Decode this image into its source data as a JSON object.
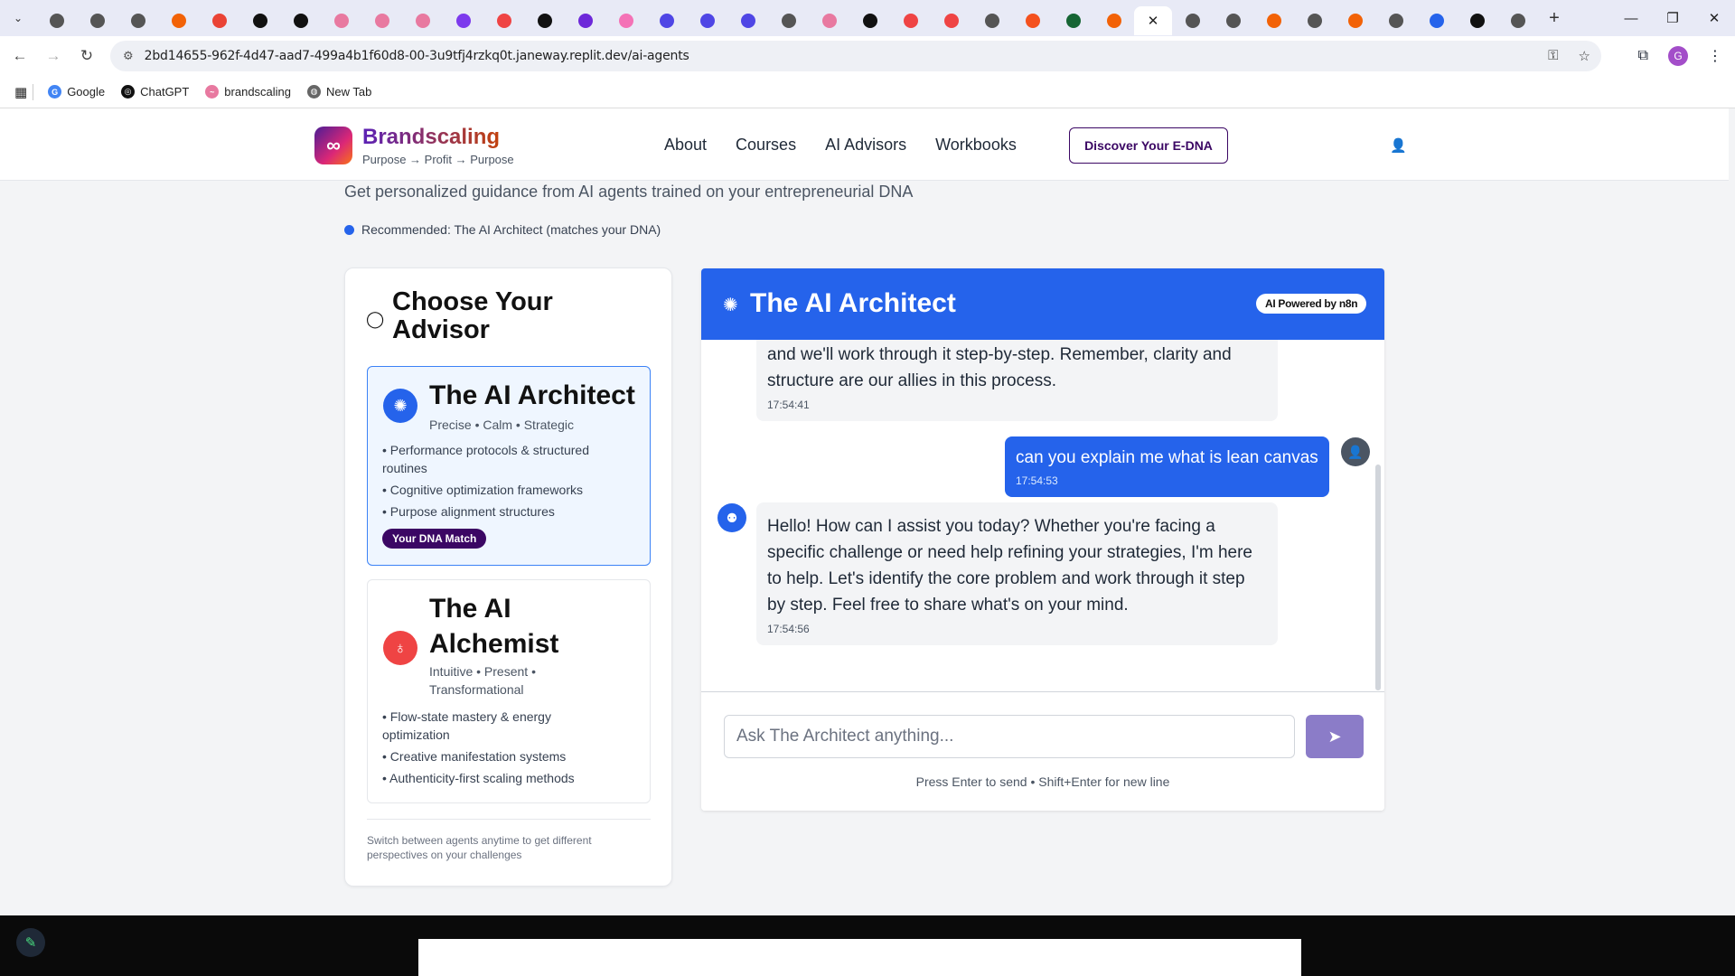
{
  "browser": {
    "url": "2bd14655-962f-4d47-aad7-499a4b1f60d8-00-3u9tfj4rzkq0t.janeway.replit.dev/ai-agents",
    "tabs": [
      {
        "icon": "extension-icon",
        "color": "#555"
      },
      {
        "icon": "extension-icon",
        "color": "#555"
      },
      {
        "icon": "extension-icon",
        "color": "#555"
      },
      {
        "icon": "replit-icon",
        "color": "#f26207"
      },
      {
        "icon": "gmail-icon",
        "color": "#ea4335"
      },
      {
        "icon": "chatgpt-icon",
        "color": "#111"
      },
      {
        "icon": "chatgpt-icon",
        "color": "#111"
      },
      {
        "icon": "brandscaling-icon",
        "color": "#e879a0"
      },
      {
        "icon": "brandscaling-icon",
        "color": "#e879a0"
      },
      {
        "icon": "brandscaling-icon",
        "color": "#e879a0"
      },
      {
        "icon": "app-icon",
        "color": "#7c3aed"
      },
      {
        "icon": "app-icon",
        "color": "#ef4444"
      },
      {
        "icon": "app-icon",
        "color": "#111"
      },
      {
        "icon": "app-icon",
        "color": "#6d28d9"
      },
      {
        "icon": "app-icon",
        "color": "#f472b6"
      },
      {
        "icon": "target-icon",
        "color": "#4f46e5"
      },
      {
        "icon": "target-icon",
        "color": "#4f46e5"
      },
      {
        "icon": "target-icon",
        "color": "#4f46e5"
      },
      {
        "icon": "globe-icon",
        "color": "#555"
      },
      {
        "icon": "brandscaling-icon",
        "color": "#e879a0"
      },
      {
        "icon": "chatgpt-icon",
        "color": "#111"
      },
      {
        "icon": "youtube-icon",
        "color": "#ef4444"
      },
      {
        "icon": "youtube-icon",
        "color": "#ef4444"
      },
      {
        "icon": "globe-icon",
        "color": "#555"
      },
      {
        "icon": "app-icon",
        "color": "#f4511e"
      },
      {
        "icon": "app-icon",
        "color": "#166534"
      },
      {
        "icon": "replit-icon",
        "color": "#f26207"
      }
    ],
    "tabs_after": [
      {
        "icon": "globe-icon",
        "color": "#555"
      },
      {
        "icon": "globe-icon",
        "color": "#555"
      },
      {
        "icon": "replit-icon",
        "color": "#f26207"
      },
      {
        "icon": "globe-icon",
        "color": "#555"
      },
      {
        "icon": "replit-icon",
        "color": "#f26207"
      },
      {
        "icon": "globe-icon",
        "color": "#555"
      },
      {
        "icon": "app-icon",
        "color": "#2563eb"
      },
      {
        "icon": "chatgpt-icon",
        "color": "#111"
      },
      {
        "icon": "app-icon",
        "color": "#555"
      }
    ],
    "active_tab_close": "✕",
    "bookmarks": [
      {
        "label": "Google",
        "color": "#4285f4",
        "glyph": "G"
      },
      {
        "label": "ChatGPT",
        "color": "#111111",
        "glyph": "◎"
      },
      {
        "label": "brandscaling",
        "color": "#e879a0",
        "glyph": "~"
      },
      {
        "label": "New Tab",
        "color": "#666666",
        "glyph": "◍"
      }
    ],
    "profile_initial": "G"
  },
  "site": {
    "brand_name": "Brandscaling",
    "brand_tagline": "Purpose → Profit → Purpose",
    "nav": [
      "About",
      "Courses",
      "AI Advisors",
      "Workbooks"
    ],
    "cta_label": "Discover Your E-DNA"
  },
  "main": {
    "subtitle": "Get personalized guidance from AI agents trained on your entrepreneurial DNA",
    "recommendation": "Recommended: The AI Architect (matches your DNA)"
  },
  "advisors": {
    "title": "Choose Your Advisor",
    "items": [
      {
        "name": "The AI Architect",
        "traits": "Precise • Calm • Strategic",
        "features": [
          "• Performance protocols & structured routines",
          "• Cognitive optimization frameworks",
          "• Purpose alignment structures"
        ],
        "badge": "Your DNA Match",
        "color": "#2563eb"
      },
      {
        "name": "The AI Alchemist",
        "traits": "Intuitive • Present • Transformational",
        "features": [
          "• Flow-state mastery & energy optimization",
          "• Creative manifestation systems",
          "• Authenticity-first scaling methods"
        ],
        "color": "#ef4444"
      }
    ],
    "footer": "Switch between agents anytime to get different perspectives on your challenges"
  },
  "chat": {
    "title": "The AI Architect",
    "powered_badge": "AI Powered by n8n",
    "messages": [
      {
        "role": "assistant",
        "text": "and we'll work through it step-by-step. Remember, clarity and structure are our allies in this process.",
        "time": "17:54:41"
      },
      {
        "role": "user",
        "text": "can you explain me what is lean canvas",
        "time": "17:54:53"
      },
      {
        "role": "assistant",
        "text": "Hello! How can I assist you today? Whether you're facing a specific challenge or need help refining your strategies, I'm here to help. Let's identify the core problem and work through it step by step. Feel free to share what's on your mind.",
        "time": "17:54:56"
      }
    ],
    "input_placeholder": "Ask The Architect anything...",
    "input_value": "",
    "hint": "Press Enter to send • Shift+Enter for new line"
  },
  "colors": {
    "primary": "#2563eb",
    "brand_purple": "#3b0764",
    "send_button": "#8b7cc8",
    "alchemist": "#ef4444"
  }
}
